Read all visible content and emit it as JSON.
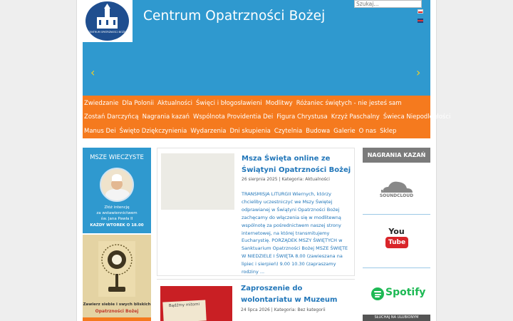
{
  "header": {
    "logo_text": "CENTRUM OPATRZNOŚCI BOŻEJ",
    "title": "Centrum Opatrzności Bożej",
    "search_placeholder": "Szukaj...",
    "arrow_left": "‹",
    "arrow_right": "›"
  },
  "nav": {
    "row1": [
      "Zwiedzanie",
      "Dla Polonii",
      "Aktualności",
      "Święci i błogosławieni",
      "Modlitwy",
      "Różaniec świętych - nie jesteś sam"
    ],
    "row2": [
      "Zostań Darczyńcą",
      "Nagrania kazań",
      "Wspólnota Providentia Dei",
      "Figura Chrystusa",
      "Krzyż Paschalny",
      "Świeca Niepodległości"
    ],
    "row3": [
      "Manus Dei",
      "Święto Dziękczynienia",
      "Wydarzenia",
      "Dni skupienia",
      "Czytelnia",
      "Budowa",
      "Galerie",
      "O nas",
      "Sklep"
    ]
  },
  "left": {
    "title": "MSZE WIECZYSTE",
    "line1": "Złóż intencję",
    "line2": "za wstawiennictwem",
    "line3": "św. Jana Pawła II",
    "line4": "KAŻDY WTOREK O 18.00",
    "caption1": "Zawierz siebie i swych bliskich",
    "caption2": "Opatrzności Bożej"
  },
  "articles": [
    {
      "title": "Msza Święta online ze Świątyni Opatrzności Bożej",
      "date": "26 sierpnia 2025",
      "category": "Kategoria: Aktualności",
      "excerpt": "TRANSMISJA LITURGII   Wiernych, którzy chcieliby uczestniczyć we Mszy Świętej odprawianej w Świątyni Opatrzności Bożej zachęcamy do włączenia się w modlitewną wspólnotę za pośrednictwem naszej strony internetowej, na której transmitujemy Eucharystię. PORZĄDEK MSZY ŚWIĘTYCH w Sanktuarium Opatrzności Bożej MSZE ŚWIĘTE W NIEDZIELE I ŚWIĘTA 8.00 (zawieszana na lipiec i sierpień) 9.00 10.30 (zapraszamy rodziny ..."
    },
    {
      "title": "Zaproszenie do wolontariatu w Muzeum",
      "date": "24 lipca 2026",
      "category": "Kategoria: Bez kategorii",
      "thumb_note": "Bądźmy mitomi"
    }
  ],
  "right": {
    "title": "NAGRANIA KAZAŃ",
    "soundcloud": "SOUNDCLOUD",
    "youtube_you": "You",
    "youtube_tube": "Tube",
    "spotify": "Spotify",
    "footer": "SŁUCHAJ NA ULUBIONYM"
  },
  "colors": {
    "header_blue": "#2f99cf",
    "nav_orange": "#f57a1e",
    "link_blue": "#2176b9",
    "arrow_yellow": "#f5d020",
    "spotify_green": "#1db954",
    "youtube_red": "#d9252a"
  }
}
